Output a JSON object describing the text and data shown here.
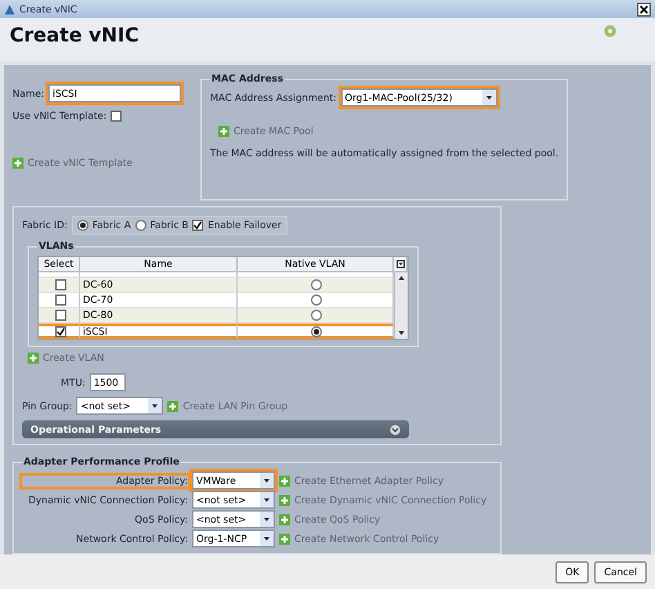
{
  "window": {
    "title": "Create vNIC"
  },
  "header": {
    "title": "Create vNIC"
  },
  "general": {
    "name": {
      "label": "Name:",
      "value": "iSCSI",
      "highlighted": true
    },
    "template": {
      "label": "Use vNIC Template:",
      "checked": false
    },
    "create_link": "Create vNIC Template"
  },
  "mac_address": {
    "title": "MAC Address",
    "assignment": {
      "label": "MAC Address Assignment:",
      "value": "Org1-MAC-Pool(25/32)",
      "highlighted": true
    },
    "create_link": "Create MAC Pool",
    "note": "The MAC address will be automatically assigned from the selected pool."
  },
  "fabric": {
    "label": "Fabric ID:",
    "options": [
      {
        "label": "Fabric A",
        "selected": true
      },
      {
        "label": "Fabric B",
        "selected": false
      }
    ],
    "failover": {
      "label": "Enable Failover",
      "checked": true
    }
  },
  "vlans": {
    "title": "VLANs",
    "columns": [
      "Select",
      "Name",
      "Native VLAN"
    ],
    "rows": [
      {
        "name": "DC-60",
        "checked": false,
        "native": false,
        "highlighted": false
      },
      {
        "name": "DC-70",
        "checked": false,
        "native": false,
        "highlighted": false
      },
      {
        "name": "DC-80",
        "checked": false,
        "native": false,
        "highlighted": false
      },
      {
        "name": "iSCSI",
        "checked": true,
        "native": true,
        "highlighted": true
      }
    ],
    "create_link": "Create VLAN"
  },
  "mtu": {
    "label": "MTU:",
    "value": "1500"
  },
  "pin_group": {
    "label": "Pin Group:",
    "value": "<not set>",
    "create_link": "Create LAN Pin Group"
  },
  "operational": {
    "title": "Operational Parameters",
    "expanded": false
  },
  "adapter_profile": {
    "title": "Adapter Performance Profile",
    "rows": [
      {
        "label": "Adapter Policy:",
        "value": "VMWare",
        "create_link": "Create Ethernet Adapter Policy",
        "highlighted": true
      },
      {
        "label": "Dynamic vNIC Connection Policy:",
        "value": "<not set>",
        "create_link": "Create Dynamic vNIC Connection Policy",
        "highlighted": false
      },
      {
        "label": "QoS Policy:",
        "value": "<not set>",
        "create_link": "Create QoS Policy",
        "highlighted": false
      },
      {
        "label": "Network Control Policy:",
        "value": "Org-1-NCP",
        "create_link": "Create Network Control Policy",
        "highlighted": false
      }
    ]
  },
  "buttons": [
    "OK",
    "Cancel"
  ]
}
